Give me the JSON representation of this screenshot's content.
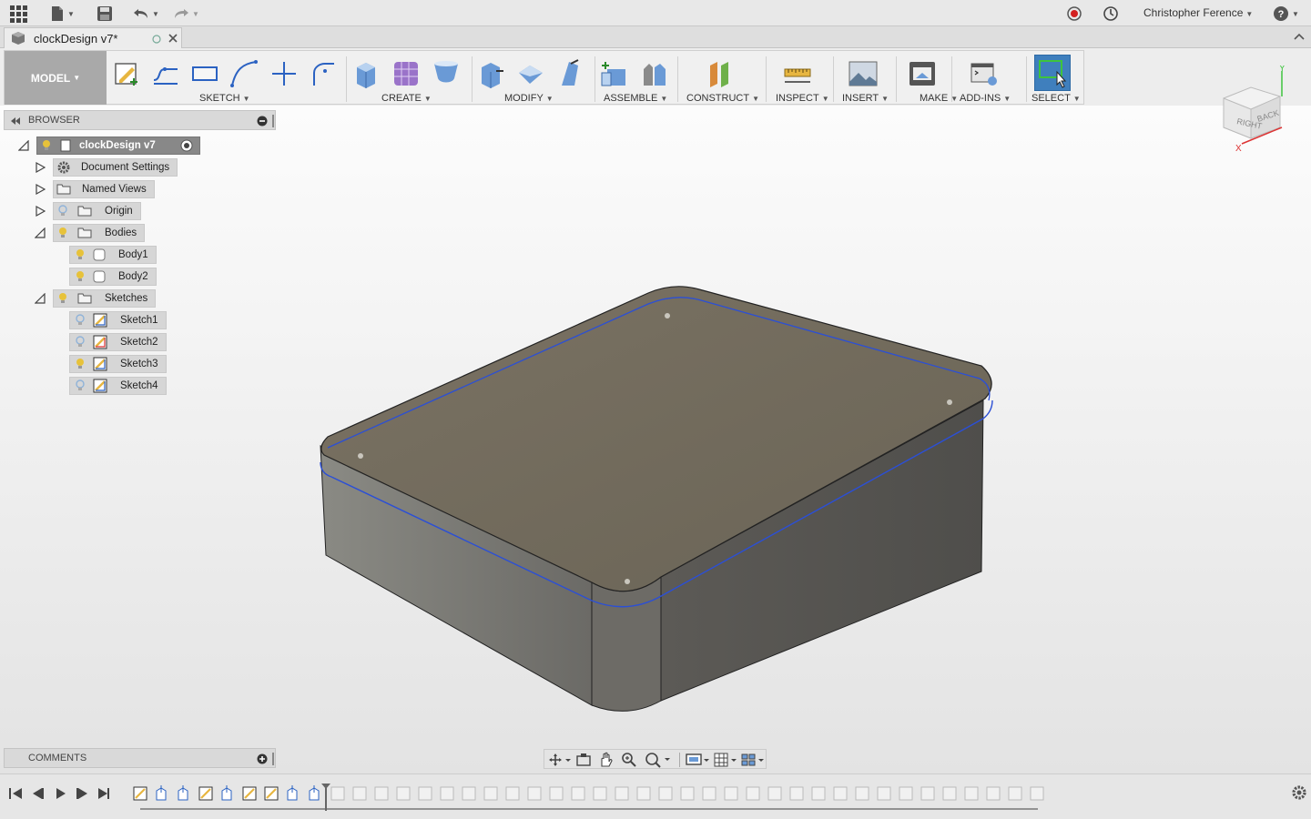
{
  "app": {
    "document_tab": "clockDesign v7*",
    "user_name": "Christopher Ference"
  },
  "ribbon": {
    "workspace": "MODEL",
    "groups": [
      "SKETCH",
      "CREATE",
      "MODIFY",
      "ASSEMBLE",
      "CONSTRUCT",
      "INSPECT",
      "INSERT",
      "MAKE",
      "ADD-INS",
      "SELECT"
    ]
  },
  "browser": {
    "title": "BROWSER",
    "root": "clockDesign v7",
    "items": [
      {
        "label": "Document Settings"
      },
      {
        "label": "Named Views"
      },
      {
        "label": "Origin"
      },
      {
        "label": "Bodies"
      },
      {
        "label": "Body1"
      },
      {
        "label": "Body2"
      },
      {
        "label": "Sketches"
      },
      {
        "label": "Sketch1"
      },
      {
        "label": "Sketch2"
      },
      {
        "label": "Sketch3"
      },
      {
        "label": "Sketch4"
      }
    ]
  },
  "comments": {
    "title": "COMMENTS"
  },
  "viewcube": {
    "faces": [
      "RIGHT",
      "BACK"
    ],
    "axes": [
      "Y",
      "X"
    ]
  },
  "colors": {
    "accent": "#3f7fbd",
    "body_top": "#6e675b",
    "body_side": "#5f5c56",
    "sketch_line": "#2b4fd6",
    "bulb_on": "#e7c23a",
    "bulb_off": "#8fb3d9"
  }
}
